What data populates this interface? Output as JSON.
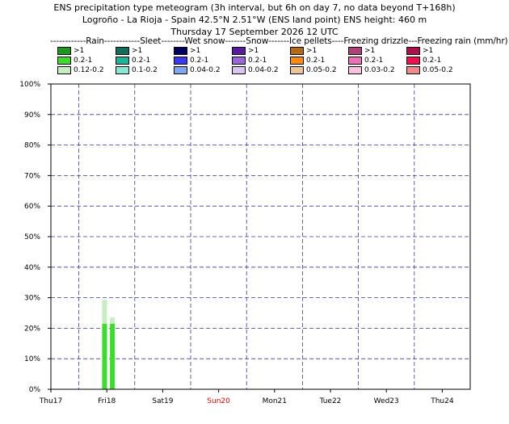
{
  "titles": {
    "line1": "ENS precipitation type meteogram (3h interval, but 6h on day 7, no data beyond T+168h)",
    "line2": "Logroño - La Rioja - Spain 42.5°N 2.51°W (ENS land point) ENS height: 460 m",
    "line3": "Thursday 17 September 2026 12 UTC"
  },
  "legend": {
    "header": "------------Rain------------Sleet--------Wet snow-------Snow-------Ice pellets----Freezing drizzle---Freezing rain (mm/hr)",
    "columns": [
      {
        "name": "rain",
        "items": [
          {
            "label": ">1",
            "color": "#1a9a1a"
          },
          {
            "label": "0.2-1",
            "color": "#3ddc2c"
          },
          {
            "label": "0.12-0.2",
            "color": "#c6eec0"
          }
        ]
      },
      {
        "name": "sleet",
        "items": [
          {
            "label": ">1",
            "color": "#0f6f5e"
          },
          {
            "label": "0.2-1",
            "color": "#1cb59a"
          },
          {
            "label": "0.1-0.2",
            "color": "#86e8d6"
          }
        ]
      },
      {
        "name": "wet-snow",
        "items": [
          {
            "label": ">1",
            "color": "#000060"
          },
          {
            "label": "0.2-1",
            "color": "#3a3aee"
          },
          {
            "label": "0.04-0.2",
            "color": "#7fa6ee"
          }
        ]
      },
      {
        "name": "snow",
        "items": [
          {
            "label": ">1",
            "color": "#5a1aa0"
          },
          {
            "label": "0.2-1",
            "color": "#9a66dc"
          },
          {
            "label": "0.04-0.2",
            "color": "#d7c6f0"
          }
        ]
      },
      {
        "name": "ice-pellets",
        "items": [
          {
            "label": ">1",
            "color": "#b86a10"
          },
          {
            "label": "0.2-1",
            "color": "#ff8c10"
          },
          {
            "label": "0.05-0.2",
            "color": "#eac49a"
          }
        ]
      },
      {
        "name": "freezing-drizzle",
        "items": [
          {
            "label": ">1",
            "color": "#b0407a"
          },
          {
            "label": "0.2-1",
            "color": "#f070b6"
          },
          {
            "label": "0.03-0.2",
            "color": "#f8c2e0"
          }
        ]
      },
      {
        "name": "freezing-rain",
        "items": [
          {
            "label": ">1",
            "color": "#b0104a"
          },
          {
            "label": "0.2-1",
            "color": "#f01050"
          },
          {
            "label": "0.05-0.2",
            "color": "#f08a8a"
          }
        ]
      }
    ]
  },
  "chart_data": {
    "type": "bar",
    "stacked": true,
    "x": [
      "Thu17",
      "Fri18",
      "Sat19",
      "Sun20",
      "Mon21",
      "Tue22",
      "Wed23",
      "Thu24"
    ],
    "x_highlight": {
      "Sun20": "#ee0000"
    },
    "ylim": [
      0,
      100
    ],
    "yticks": [
      0,
      10,
      20,
      30,
      40,
      50,
      60,
      70,
      80,
      90,
      100
    ],
    "ytick_labels": [
      "0%",
      "10%",
      "20%",
      "30%",
      "40%",
      "50%",
      "60%",
      "70%",
      "80%",
      "90%",
      "100%"
    ],
    "grid": true,
    "bars": [
      {
        "day_offset": 0.96,
        "segments": [
          {
            "type": "rain 0.2-1",
            "value": 21.5,
            "color": "#3ddc2c"
          },
          {
            "type": "rain 0.12-0.2",
            "value": 7.8,
            "color": "#c6eec0"
          }
        ]
      },
      {
        "day_offset": 1.1,
        "segments": [
          {
            "type": "rain 0.2-1",
            "value": 21.5,
            "color": "#3ddc2c"
          },
          {
            "type": "rain 0.12-0.2",
            "value": 2.0,
            "color": "#c6eec0"
          }
        ]
      }
    ]
  }
}
